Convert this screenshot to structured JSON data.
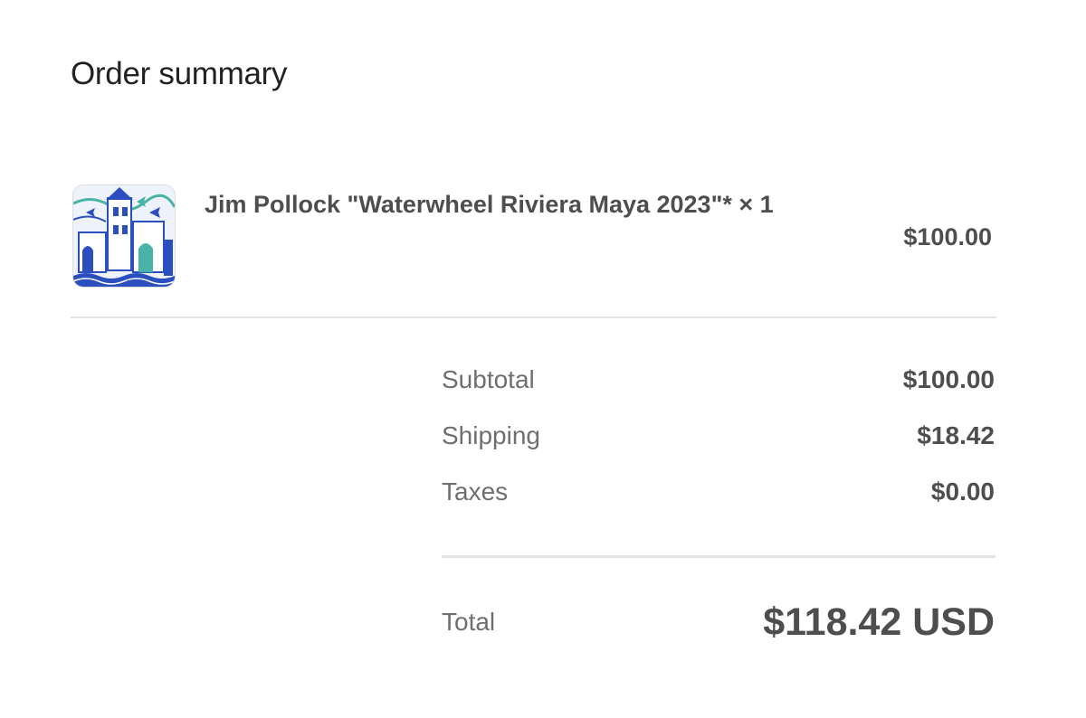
{
  "order_summary": {
    "title": "Order summary"
  },
  "line_item": {
    "name": "Jim Pollock \"Waterwheel Riviera Maya 2023\"* × 1",
    "price": "$100.00",
    "thumbnail_icon": "poster-thumbnail",
    "thumbnail_colors": [
      "#2c4fbf",
      "#4ab3a8",
      "#eef3fb"
    ]
  },
  "totals": {
    "subtotal_label": "Subtotal",
    "subtotal_value": "$100.00",
    "shipping_label": "Shipping",
    "shipping_value": "$18.42",
    "taxes_label": "Taxes",
    "taxes_value": "$0.00"
  },
  "grand_total": {
    "label": "Total",
    "value": "$118.42 USD"
  }
}
